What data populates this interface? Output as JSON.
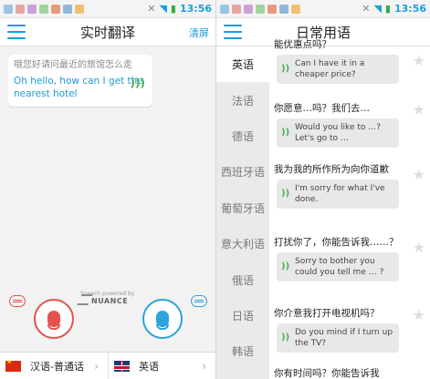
{
  "status_left": {
    "time": "13:56"
  },
  "status_right": {
    "time": "13:56"
  },
  "left": {
    "title": "实时翻译",
    "clear_label": "清屏",
    "bubble": {
      "source": "哦您好请问最近的旅馆怎么走",
      "target": "Oh hello, how can I get the nearest hotel"
    },
    "powered_by": "Speech powered by",
    "nuance": "NUANCE",
    "source_lang": "汉语-普通话",
    "target_lang": "英语"
  },
  "right": {
    "title": "日常用语",
    "languages": [
      "英语",
      "法语",
      "德语",
      "西班牙语",
      "葡萄牙语",
      "意大利语",
      "俄语",
      "日语",
      "韩语"
    ],
    "phrases": [
      {
        "cn": "能优惠点吗？",
        "en": "Can I have it in a cheaper price?"
      },
      {
        "cn": "你愿意…吗？我们去…",
        "en": "Would you like to …? Let's go to …"
      },
      {
        "cn": "我为我的所作所为向你道歉",
        "en": "I'm sorry for what I've done."
      },
      {
        "cn": "打扰你了，你能告诉我……？",
        "en": "Sorry to bother you could you tell me … ?"
      },
      {
        "cn": "你介意我打开电视机吗？",
        "en": "Do you mind if I turn up the TV?"
      },
      {
        "cn": "你有时间吗？你能告诉我",
        "en": ""
      }
    ]
  },
  "colors": {
    "accent": "#1a9ad9",
    "record_source": "#e2524d",
    "record_target": "#2ba3db",
    "sound": "#46b24e"
  }
}
